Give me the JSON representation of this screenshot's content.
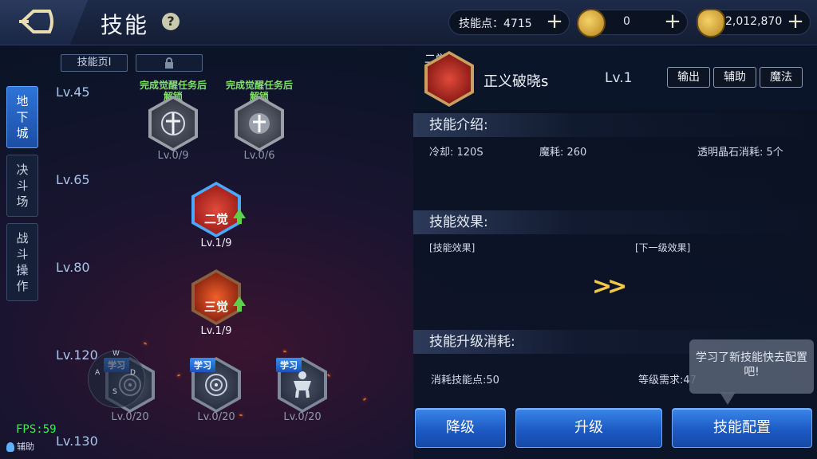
{
  "header": {
    "title": "技能",
    "help_icon": "?",
    "skill_points_label": "技能点：4715",
    "gold_value": "0",
    "coin_value": "2,012,870"
  },
  "side_tabs": [
    {
      "label": "地下城",
      "active": true
    },
    {
      "label": "决斗场",
      "active": false
    },
    {
      "label": "战斗操作",
      "active": false
    }
  ],
  "tree": {
    "page_tab": "技能页Ⅰ",
    "levels": [
      "Lv.45",
      "Lv.65",
      "Lv.80",
      "Lv.120",
      "Lv.130"
    ],
    "lock_text": "完成觉醒任务后解锁",
    "nodes": [
      {
        "level": "Lv.0/9",
        "locked": true
      },
      {
        "level": "Lv.0/6",
        "locked": true
      },
      {
        "level": "Lv.1/9",
        "badge": "二觉",
        "upgrade": true
      },
      {
        "level": "Lv.1/9",
        "badge": "三觉",
        "upgrade": true
      },
      {
        "level": "Lv.0/20",
        "tag": "学习"
      },
      {
        "level": "Lv.0/20",
        "tag": "学习"
      },
      {
        "level": "Lv.0/20",
        "tag": "学习"
      }
    ],
    "joystick": {
      "w": "W",
      "a": "A",
      "s": "S",
      "d": "D"
    }
  },
  "detail": {
    "name": "正义破晓s",
    "level": "Lv.1",
    "icon_badge": "二觉",
    "types": [
      "输出",
      "辅助",
      "魔法"
    ],
    "intro_title": "技能介绍:",
    "cooldown": "冷却: 120S",
    "mana": "魔耗: 260",
    "crystal": "透明晶石消耗: 5个",
    "effect_title": "技能效果:",
    "effect_current": "[技能效果]",
    "effect_next": "[下一级效果]",
    "cost_title": "技能升级消耗:",
    "cost_points": "消耗技能点:50",
    "cost_level": "等级需求:47",
    "buttons": {
      "downgrade": "降级",
      "upgrade": "升级",
      "config": "技能配置"
    },
    "tooltip": "学习了新技能快去配置吧!"
  },
  "hud": {
    "fps": "FPS:59",
    "assist": "辅助"
  },
  "colors": {
    "accent_blue": "#1c5ac4",
    "upgrade_green": "#5ed04a",
    "lock_green": "#7fe06a",
    "gold": "#f2c84a"
  }
}
